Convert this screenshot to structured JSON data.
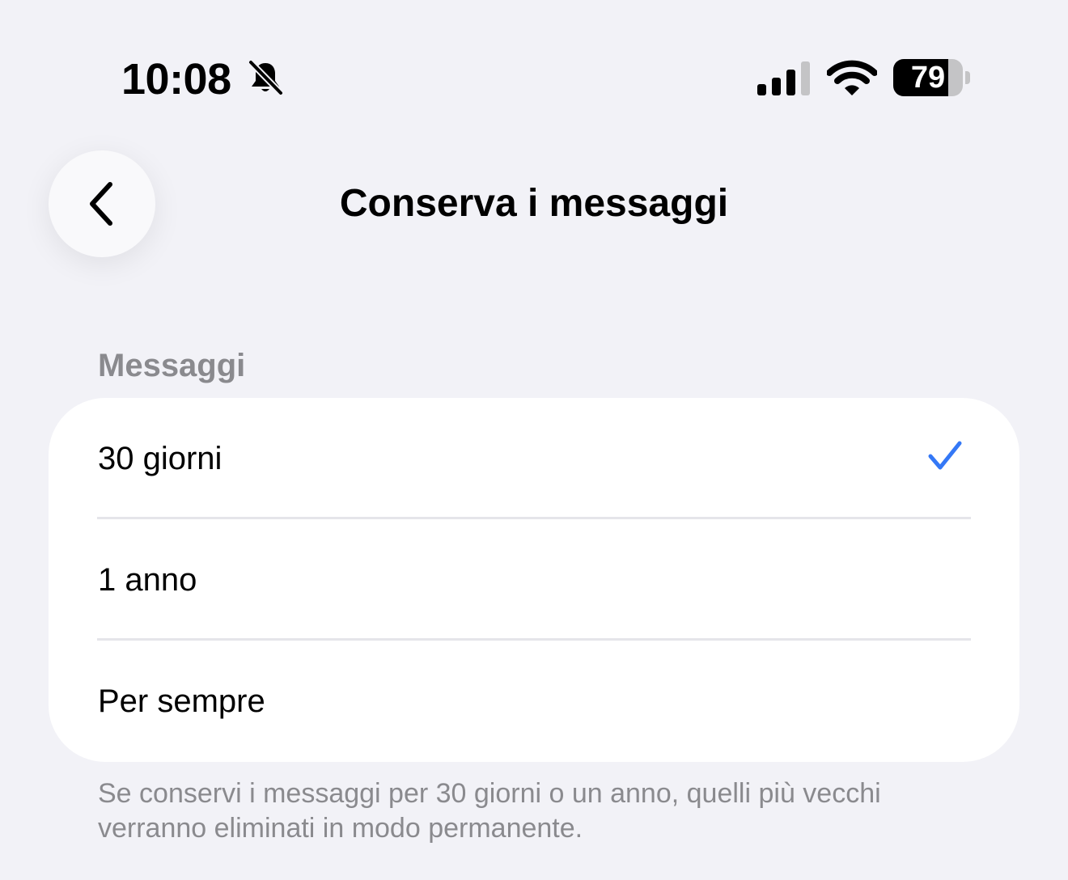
{
  "status_bar": {
    "time": "10:08",
    "battery_level": "79",
    "battery_fraction": 0.79,
    "icons": [
      "bell-slash-icon",
      "cellular-signal-icon",
      "wifi-icon",
      "battery-icon"
    ]
  },
  "nav": {
    "title": "Conserva i messaggi",
    "back_icon": "chevron-left-icon"
  },
  "section": {
    "header": "Messaggi",
    "options": [
      {
        "label": "30 giorni",
        "selected": true
      },
      {
        "label": "1 anno",
        "selected": false
      },
      {
        "label": "Per sempre",
        "selected": false
      }
    ],
    "footer": "Se conservi i messaggi per 30 giorni o un anno, quelli più vecchi verranno eliminati in modo permanente."
  },
  "colors": {
    "background": "#f2f2f7",
    "card": "#ffffff",
    "accent": "#3478f6",
    "secondary_text": "#8a8a8e"
  }
}
